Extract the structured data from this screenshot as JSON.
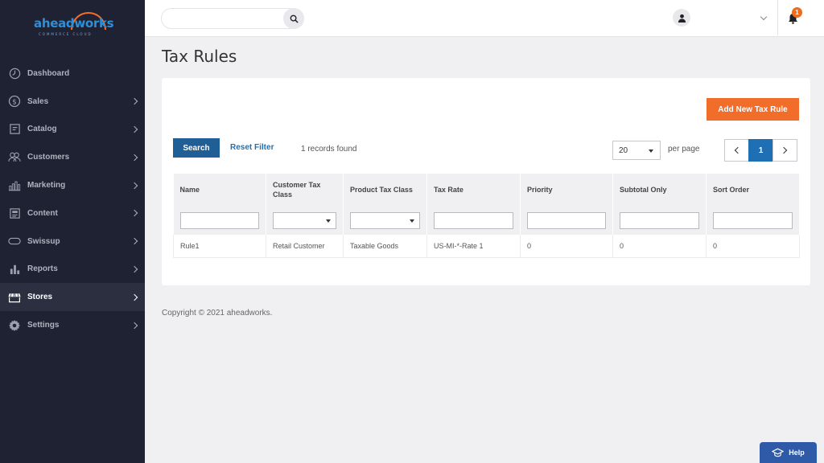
{
  "brand": {
    "logo_text": "aheadworks",
    "logo_subtitle": "COMMERCE CLOUD"
  },
  "sidebar": {
    "items": [
      {
        "label": "Dashboard",
        "icon": "dashboard-icon",
        "has_submenu": false
      },
      {
        "label": "Sales",
        "icon": "dollar-icon",
        "has_submenu": true
      },
      {
        "label": "Catalog",
        "icon": "catalog-icon",
        "has_submenu": true
      },
      {
        "label": "Customers",
        "icon": "customers-icon",
        "has_submenu": true
      },
      {
        "label": "Marketing",
        "icon": "marketing-icon",
        "has_submenu": true
      },
      {
        "label": "Content",
        "icon": "content-icon",
        "has_submenu": true
      },
      {
        "label": "Swissup",
        "icon": "swissup-icon",
        "has_submenu": true
      },
      {
        "label": "Reports",
        "icon": "reports-icon",
        "has_submenu": true
      },
      {
        "label": "Stores",
        "icon": "stores-icon",
        "has_submenu": true,
        "active": true
      },
      {
        "label": "Settings",
        "icon": "gear-icon",
        "has_submenu": true
      }
    ]
  },
  "header": {
    "search_placeholder": "",
    "notification_count": "1"
  },
  "page": {
    "title": "Tax Rules",
    "add_button": "Add New Tax Rule",
    "search_button": "Search",
    "reset_filter": "Reset Filter",
    "records_found": "1 records found",
    "per_page_value": "20",
    "per_page_label": "per page",
    "current_page": "1"
  },
  "grid": {
    "columns": [
      "Name",
      "Customer Tax Class",
      "Product Tax Class",
      "Tax Rate",
      "Priority",
      "Subtotal Only",
      "Sort Order"
    ],
    "rows": [
      [
        "Rule1",
        "Retail Customer",
        "Taxable Goods",
        "US-MI-*-Rate 1",
        "0",
        "0",
        "0"
      ]
    ]
  },
  "footer": {
    "copyright": "Copyright © 2021 aheadworks."
  },
  "help": {
    "label": "Help"
  },
  "colors": {
    "sidebar": "#1f2232",
    "accent": "#f26c2a",
    "primary": "#1f6fb5"
  }
}
